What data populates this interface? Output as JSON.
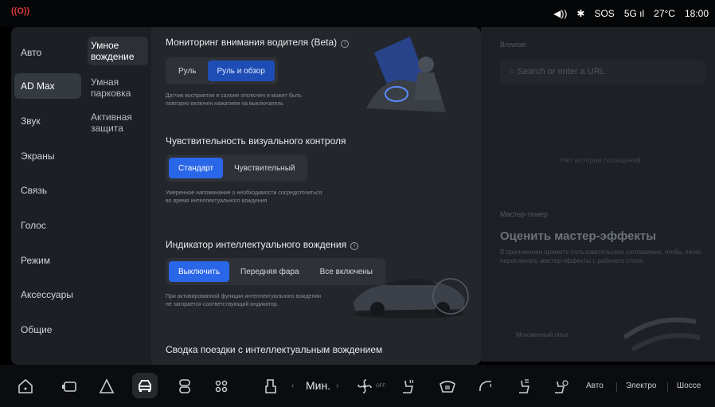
{
  "statusbar": {
    "logo": "((O))",
    "sound": "◀))",
    "bluetooth": "✱",
    "sos": "SOS",
    "network": "5G ıl",
    "temperature": "27°C",
    "time": "18:00"
  },
  "background": {
    "browser_label": "Browser",
    "search_placeholder": "Search or enter a URL",
    "history_label": "Нет истории посещений",
    "tuner_label": "Мастер-тюнер",
    "tuner_title": "Оценить мастер-эффекты",
    "tuner_desc": "В приложении примите пользовательское соглашение, чтобы легко переключать мастер-эффекты с рабочего стола",
    "instant_label": "Мгновенный опыт"
  },
  "nav_primary": [
    "Авто",
    "AD Max",
    "Звук",
    "Экраны",
    "Связь",
    "Голос",
    "Режим",
    "Аксессуары",
    "Общие"
  ],
  "nav_primary_active": "AD Max",
  "nav_secondary": [
    "Умное вождение",
    "Умная парковка",
    "Активная защита"
  ],
  "nav_secondary_active": "Умное вождение",
  "sections": {
    "attention": {
      "title": "Мониторинг внимания водителя (Beta)",
      "options": [
        "Руль",
        "Руль и обзор"
      ],
      "selected": "Руль и обзор",
      "note": "Датчик восприятия в салоне отключен и может быть повторно включен нажатием на выключатель"
    },
    "sensitivity": {
      "title": "Чувствительность визуального контроля",
      "options": [
        "Стандарт",
        "Чувствительный"
      ],
      "selected": "Стандарт",
      "note": "Умеренное напоминание о необходимости сосредоточиться во время интеллектуального вождения"
    },
    "indicator": {
      "title": "Индикатор интеллектуального вождения",
      "options": [
        "Выключить",
        "Передняя фара",
        "Все включены"
      ],
      "selected": "Выключить",
      "note": "При активированной функции интеллектуального вождения не загорается соответствующий индикатор."
    },
    "summary": {
      "title": "Сводка поездки с интеллектуальным вождением"
    }
  },
  "dock": {
    "temperature_label": "Мин.",
    "fan_state": "OFF",
    "modes": [
      "Авто",
      "Электро",
      "Шоссе"
    ]
  },
  "colors": {
    "accent": "#2a66e8",
    "panel": "#23262b",
    "nav": "#1c1f23"
  }
}
